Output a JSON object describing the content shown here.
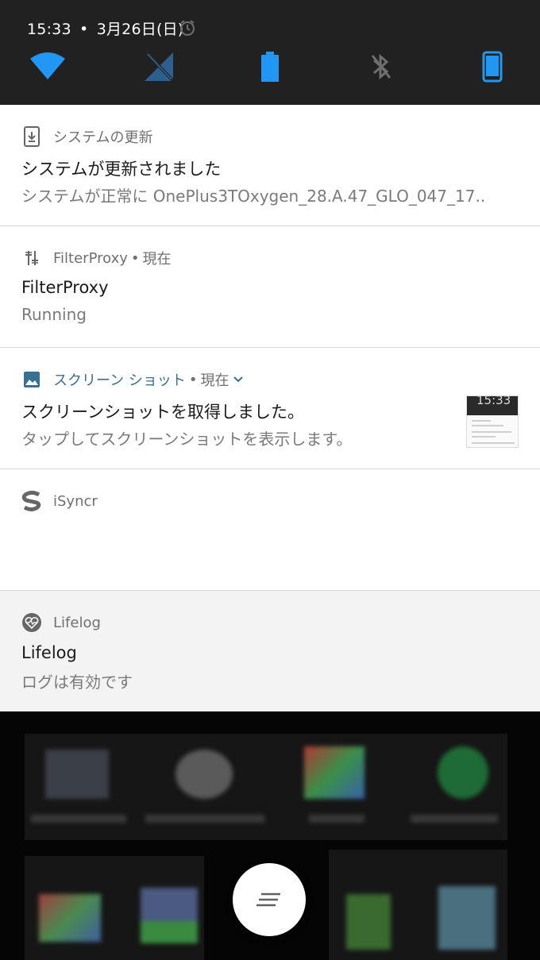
{
  "status_bar": {
    "clock": "15:33",
    "separator": "•",
    "date": "3月26日(日)"
  },
  "quick_settings": {
    "tiles": [
      {
        "name": "wifi-icon",
        "state": "on",
        "color": "#2196f3"
      },
      {
        "name": "mobile-data-off-icon",
        "state": "off",
        "color": "#2f5f8f"
      },
      {
        "name": "battery-icon",
        "state": "on",
        "color": "#2196f3"
      },
      {
        "name": "bluetooth-icon",
        "state": "off",
        "color": "#6e6e6e"
      },
      {
        "name": "phone-icon",
        "state": "on",
        "color": "#2196f3"
      }
    ]
  },
  "notifications": [
    {
      "app": "システムの更新",
      "time": "",
      "title": "システムが更新されました",
      "text": "システムが正常に OnePlus3TOxygen_28.A.47_GLO_047_17.."
    },
    {
      "app": "FilterProxy",
      "time": "現在",
      "title": "FilterProxy",
      "text": "Running"
    },
    {
      "app": "スクリーン ショット",
      "time": "現在",
      "title": "スクリーンショットを取得しました。",
      "text": "タップしてスクリーンショットを表示します。",
      "thumbnail_clock": "15:33"
    },
    {
      "app": "iSyncr",
      "time": "",
      "title": "",
      "text": ""
    },
    {
      "app": "Lifelog",
      "time": "",
      "title": "Lifelog",
      "text": "ログは有効です"
    }
  ],
  "colors": {
    "accent": "#2196f3",
    "header_bg": "#212121",
    "app_name_accent": "#3a6f8f"
  },
  "fab": {
    "icon": "clear-all-icon"
  }
}
